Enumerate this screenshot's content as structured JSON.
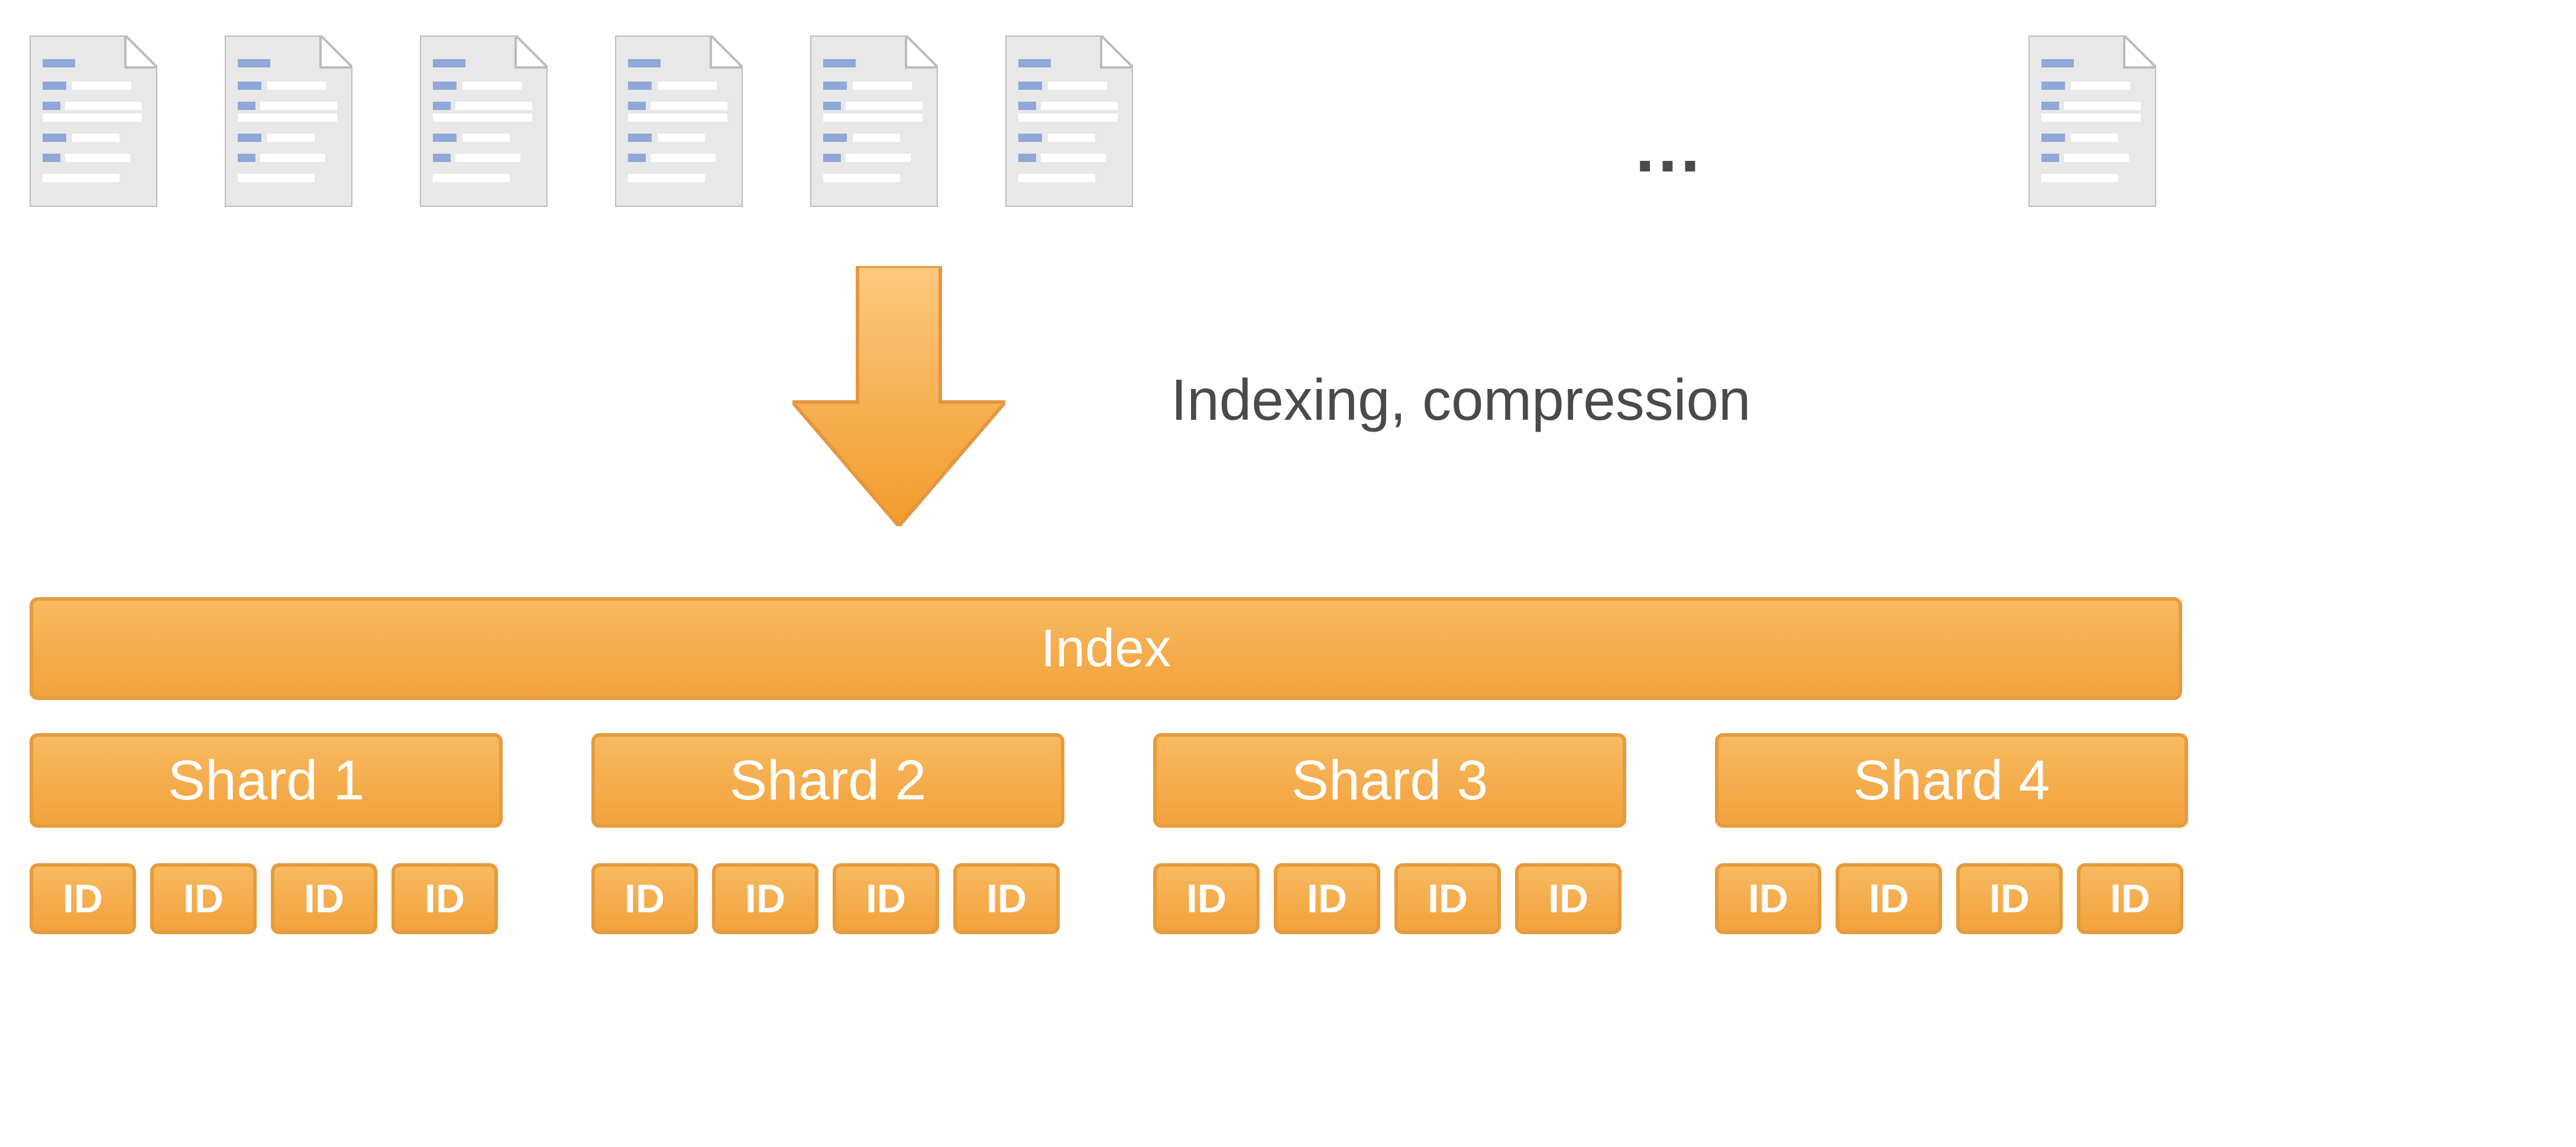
{
  "ellipsis": "…",
  "arrow_label": "Indexing, compression",
  "index_label": "Index",
  "shards": [
    "Shard 1",
    "Shard 2",
    "Shard 3",
    "Shard 4"
  ],
  "id_label": "ID",
  "colors": {
    "orange_border": "#e59c3c",
    "orange_fill_top": "#f8b95f",
    "orange_fill_bottom": "#f2a23d",
    "arrow_top": "#fcc97e",
    "arrow_bottom": "#f19b2c",
    "doc_fill": "#e8e8e8",
    "doc_stroke": "#bcbcbc",
    "doc_line_blue": "#8fa8d8",
    "doc_line_gray": "#ffffff",
    "text": "#4a4a4a"
  },
  "doc_count_left": 6
}
